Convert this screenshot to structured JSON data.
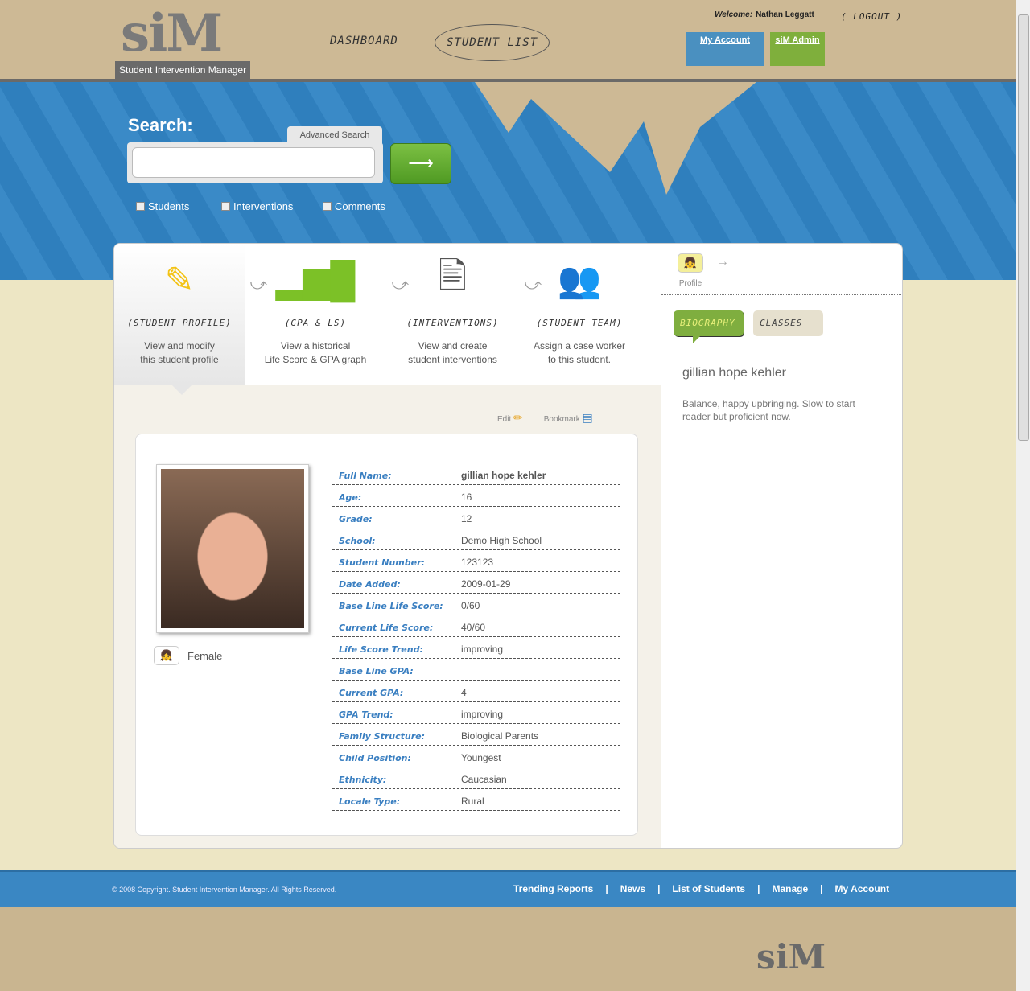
{
  "header": {
    "logo": "siM",
    "tagline": "Student Intervention Manager",
    "nav": [
      "DASHBOARD",
      "STUDENT LIST"
    ],
    "welcome_label": "Welcome:",
    "user": "Nathan Leggatt",
    "logout": "( LOGOUT )",
    "tabs": [
      {
        "label": "My Account",
        "color": "#4a90c0"
      },
      {
        "label": "siM Admin",
        "color": "#7faf3c"
      }
    ]
  },
  "search": {
    "label": "Search:",
    "advanced": "Advanced Search",
    "value": "",
    "go_icon": "arrow-right",
    "filters": [
      "Students",
      "Interventions",
      "Comments"
    ]
  },
  "steps": [
    {
      "icon": "highlighter",
      "caption": "(STUDENT PROFILE)",
      "desc1": "View and modify",
      "desc2": "this student profile"
    },
    {
      "icon": "bar-chart",
      "caption": "(GPA & LS)",
      "desc1": "View a historical",
      "desc2": "Life Score & GPA graph"
    },
    {
      "icon": "document-pen",
      "caption": "(INTERVENTIONS)",
      "desc1": "View and create",
      "desc2": "student interventions"
    },
    {
      "icon": "team",
      "caption": "(STUDENT TEAM)",
      "desc1": "Assign a case worker",
      "desc2": "to this student."
    }
  ],
  "actions": {
    "edit": "Edit",
    "bookmark": "Bookmark"
  },
  "profile": {
    "gender": "Female",
    "fields": [
      {
        "k": "Full Name:",
        "v": "gillian hope kehler"
      },
      {
        "k": "Age:",
        "v": "16"
      },
      {
        "k": "Grade:",
        "v": "12"
      },
      {
        "k": "School:",
        "v": "Demo High School"
      },
      {
        "k": "Student Number:",
        "v": "123123"
      },
      {
        "k": "Date Added:",
        "v": "2009-01-29"
      },
      {
        "k": "Base Line Life Score:",
        "v": "0/60"
      },
      {
        "k": "Current Life Score:",
        "v": "40/60"
      },
      {
        "k": "Life Score Trend:",
        "v": "improving"
      },
      {
        "k": "Base Line GPA:",
        "v": ""
      },
      {
        "k": "Current GPA:",
        "v": "4"
      },
      {
        "k": "GPA Trend:",
        "v": "improving"
      },
      {
        "k": "Family Structure:",
        "v": "Biological Parents"
      },
      {
        "k": "Child Position:",
        "v": "Youngest"
      },
      {
        "k": "Ethnicity:",
        "v": "Caucasian"
      },
      {
        "k": "Locale Type:",
        "v": "Rural"
      }
    ]
  },
  "sidebar": {
    "profile_label": "Profile",
    "tabs": [
      "BIOGRAPHY",
      "CLASSES"
    ],
    "name": "gillian hope kehler",
    "bio": "Balance, happy upbringing. Slow to start reader but proficient now."
  },
  "footer": {
    "copyright": "© 2008 Copyright. Student Intervention Manager. All Rights Reserved.",
    "links": [
      "Trending Reports",
      "News",
      "List of Students",
      "Manage",
      "My Account"
    ],
    "logo": "siM"
  }
}
